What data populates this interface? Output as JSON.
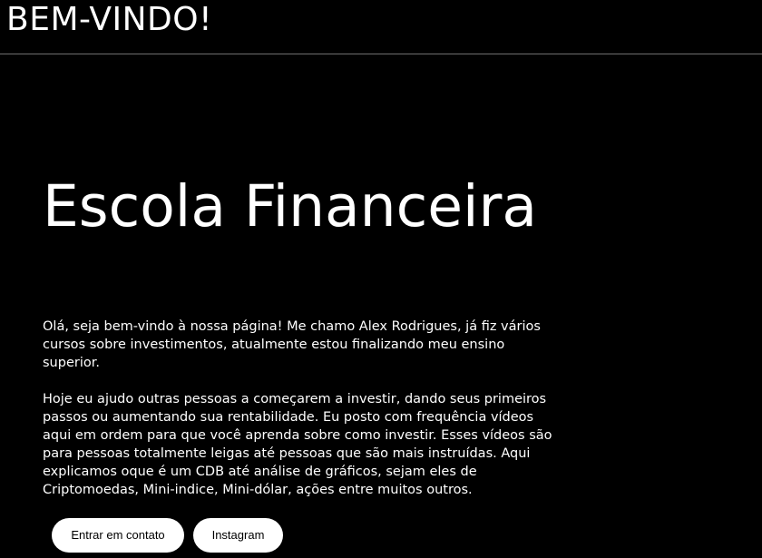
{
  "header": {
    "title": "BEM-VINDO!"
  },
  "hero": {
    "title": "Escola Financeira",
    "paragraphs": [
      "Olá, seja bem-vindo à nossa página! Me chamo Alex Rodrigues, já fiz vários cursos sobre investimentos, atualmente estou finalizando meu ensino superior.",
      "Hoje eu ajudo outras pessoas a começarem a investir, dando seus primeiros passos ou aumentando sua rentabilidade. Eu posto com frequência vídeos aqui em ordem para que você aprenda sobre como investir. Esses vídeos são para pessoas totalmente leigas até pessoas que são mais instruídas. Aqui explicamos oque é um CDB até análise de gráficos, sejam eles de Criptomoedas, Mini-indice, Mini-dólar, ações entre muitos outros."
    ]
  },
  "buttons": {
    "contact_label": "Entrar em contato",
    "instagram_label": "Instagram"
  },
  "colors": {
    "background": "#000000",
    "text": "#ffffff",
    "button_bg": "#ffffff",
    "button_text": "#000000"
  }
}
